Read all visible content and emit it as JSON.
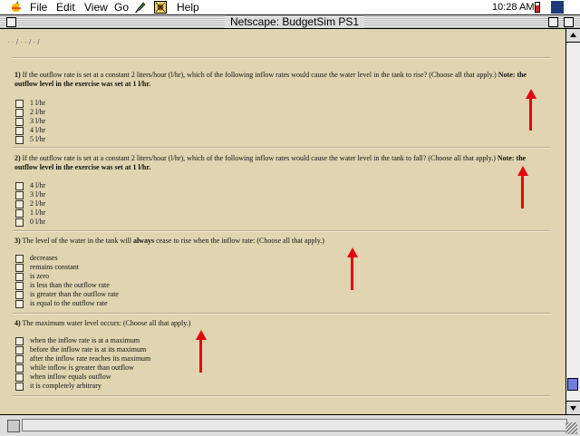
{
  "menubar": {
    "items": [
      "File",
      "Edit",
      "View",
      "Go",
      "Help"
    ],
    "clock": "10:28 AM"
  },
  "window": {
    "title": "Netscape: BudgetSim  PS1"
  },
  "page": {
    "breadcrumb": "· · / · · / · /",
    "questions": [
      {
        "number": "1)",
        "text": " If the outflow rate is set at a constant 2 liters/hour (l/hr), which of the following inflow rates would cause the water level in the tank to rise? (Choose all that apply.) ",
        "note": "Note:  the outflow level in the exercise was set at 1 l/hr.",
        "options": [
          "1 l/hr",
          "2 l/hr",
          "3 l/hr",
          "4 l/hr",
          "5 l/hr"
        ]
      },
      {
        "number": "2)",
        "text": " If the outflow rate is set at a constant 2 liters/hour (l/hr), which of the following inflow rates would cause the water level in the tank to fall? (Choose all that apply.) ",
        "note": "Note: the outflow level in the exercise was set at 1 l/hr.",
        "options": [
          "4 l/hr",
          "3 l/hr",
          "2 l/hr",
          "1 l/hr",
          "0 l/hr"
        ]
      },
      {
        "number": "3)",
        "text_before": " The level of the water in the tank will ",
        "emphasis": "always",
        "text_after": " cease to rise when the inflow rate: (Choose all that apply.)",
        "options": [
          "decreases",
          "remains constant",
          "is zero",
          "is less than the outflow rate",
          "is greater than the outflow rate",
          "is equal to the outflow rate"
        ]
      },
      {
        "number": "4)",
        "text": " The maximum water level occurs: (Choose all that apply.)",
        "options": [
          "when the inflow rate is at a maximum",
          "before the inflow rate is at its maximum",
          "after the inflow rate reaches its maximum",
          "while inflow is greater than outflow",
          "when inflow equals outflow",
          "it is completely arbitrary"
        ]
      }
    ]
  },
  "colors": {
    "page_background": "#e0d4b1",
    "annotation_arrow": "#e8000e",
    "scroll_thumb": "#6f7ee0"
  },
  "icons": [
    "apple-menu-icon",
    "pen-tool-icon",
    "app-switcher-icon",
    "battery-icon",
    "netscape-icon",
    "close-box-icon",
    "zoom-box-icon",
    "collapse-box-icon",
    "security-lock-icon",
    "resize-grip-icon"
  ]
}
